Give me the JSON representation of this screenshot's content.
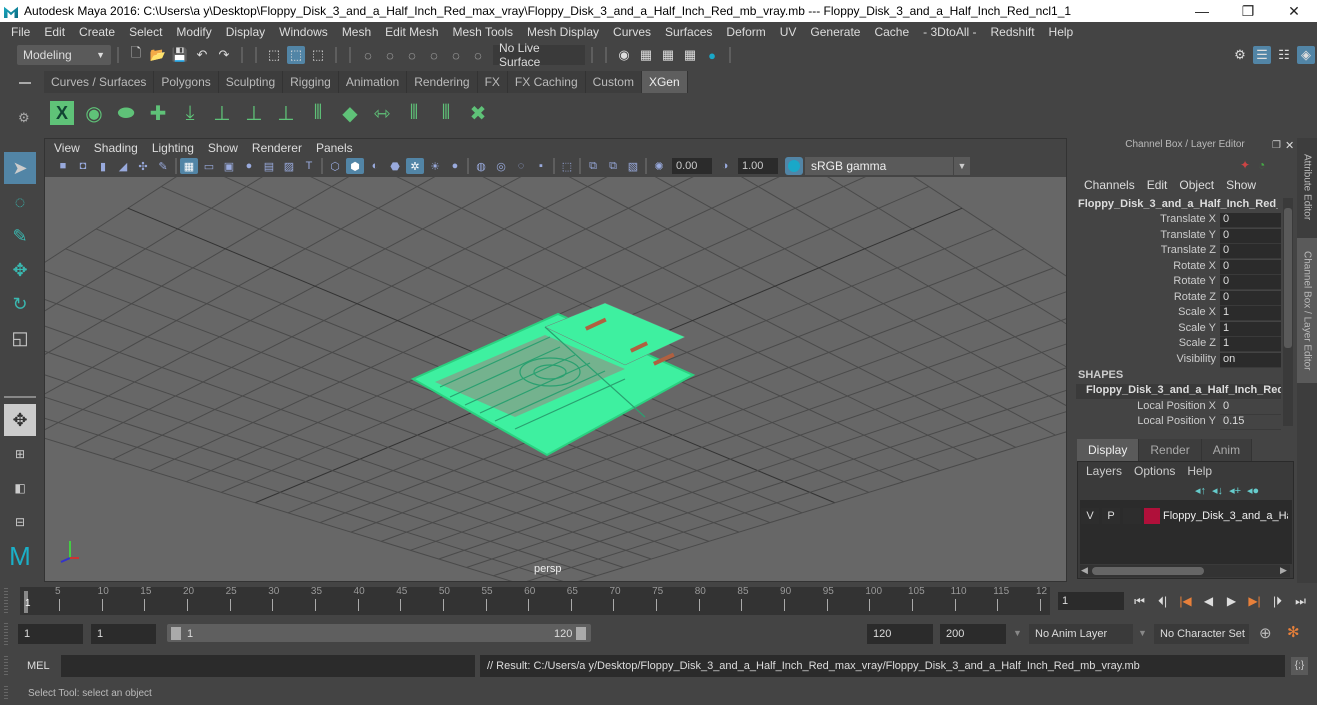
{
  "window": {
    "title": "Autodesk Maya 2016: C:\\Users\\a y\\Desktop\\Floppy_Disk_3_and_a_Half_Inch_Red_max_vray\\Floppy_Disk_3_and_a_Half_Inch_Red_mb_vray.mb   ---   Floppy_Disk_3_and_a_Half_Inch_Red_ncl1_1",
    "minimize": "—",
    "restore": "❐",
    "close": "✕"
  },
  "menubar": [
    "File",
    "Edit",
    "Create",
    "Select",
    "Modify",
    "Display",
    "Windows",
    "Mesh",
    "Edit Mesh",
    "Mesh Tools",
    "Mesh Display",
    "Curves",
    "Surfaces",
    "Deform",
    "UV",
    "Generate",
    "Cache",
    "- 3DtoAll -",
    "Redshift",
    "Help"
  ],
  "statusline": {
    "mode": "Modeling",
    "live_surface": "No Live Surface"
  },
  "shelf": {
    "tabs": [
      "Curves / Surfaces",
      "Polygons",
      "Sculpting",
      "Rigging",
      "Animation",
      "Rendering",
      "FX",
      "FX Caching",
      "Custom",
      "XGen"
    ],
    "active_tab": "XGen",
    "icons": [
      "xgen-window-icon",
      "xgen-preview-icon",
      "xgen-hide-preview-icon",
      "xgen-add-guides-icon",
      "xgen-place-guides-icon",
      "xgen-add-guide-icon",
      "xgen-show-guides-icon",
      "xgen-lock-guides-icon",
      "xgen-guides-icon",
      "xgen-patch-icon",
      "xgen-length-icon",
      "xgen-select-guides-icon",
      "xgen-clip-guides-icon",
      "xgen-delete-guides-icon"
    ]
  },
  "viewport": {
    "menu": [
      "View",
      "Shading",
      "Lighting",
      "Show",
      "Renderer",
      "Panels"
    ],
    "exposure": "0.00",
    "gamma": "1.00",
    "color_space": "sRGB gamma",
    "camera_label": "persp"
  },
  "channel_box": {
    "header": "Channel Box / Layer Editor",
    "menu": [
      "Channels",
      "Edit",
      "Object",
      "Show"
    ],
    "object_name": "Floppy_Disk_3_and_a_Half_Inch_Red_...",
    "attributes": [
      {
        "label": "Translate X",
        "value": "0"
      },
      {
        "label": "Translate Y",
        "value": "0"
      },
      {
        "label": "Translate Z",
        "value": "0"
      },
      {
        "label": "Rotate X",
        "value": "0"
      },
      {
        "label": "Rotate Y",
        "value": "0"
      },
      {
        "label": "Rotate Z",
        "value": "0"
      },
      {
        "label": "Scale X",
        "value": "1"
      },
      {
        "label": "Scale Y",
        "value": "1"
      },
      {
        "label": "Scale Z",
        "value": "1"
      },
      {
        "label": "Visibility",
        "value": "on"
      }
    ],
    "shapes_label": "SHAPES",
    "shape_name": "Floppy_Disk_3_and_a_Half_Inch_Red...",
    "shape_attributes": [
      {
        "label": "Local Position X",
        "value": "0"
      },
      {
        "label": "Local Position Y",
        "value": "0.15"
      }
    ]
  },
  "side_tabs": [
    "Attribute Editor",
    "Channel Box / Layer Editor"
  ],
  "layer_editor": {
    "tabs": [
      "Display",
      "Render",
      "Anim"
    ],
    "active_tab": "Display",
    "menu": [
      "Layers",
      "Options",
      "Help"
    ],
    "layer": {
      "v": "V",
      "p": "P",
      "color": "#b0103a",
      "name": "Floppy_Disk_3_and_a_Ha"
    }
  },
  "timeline": {
    "ticks": [
      "5",
      "10",
      "15",
      "20",
      "25",
      "30",
      "35",
      "40",
      "45",
      "50",
      "55",
      "60",
      "65",
      "70",
      "75",
      "80",
      "85",
      "90",
      "95",
      "100",
      "105",
      "110",
      "115",
      "12"
    ],
    "current_frame": "1",
    "current_frame_field": "1"
  },
  "range": {
    "start_frame": "1",
    "playback_start": "1",
    "range_start": "1",
    "range_end": "120",
    "playback_end": "120",
    "end_frame": "200",
    "anim_layer": "No Anim Layer",
    "character_set": "No Character Set"
  },
  "command_line": {
    "label": "MEL",
    "input_value": "",
    "result": "// Result: C:/Users/a y/Desktop/Floppy_Disk_3_and_a_Half_Inch_Red_max_vray/Floppy_Disk_3_and_a_Half_Inch_Red_mb_vray.mb"
  },
  "help_line": "Select Tool: select an object",
  "colors": {
    "accent": "#5285a6",
    "wireframe": "#3ef0a0",
    "layer_color": "#b0103a",
    "key_orange": "#e8803a"
  }
}
